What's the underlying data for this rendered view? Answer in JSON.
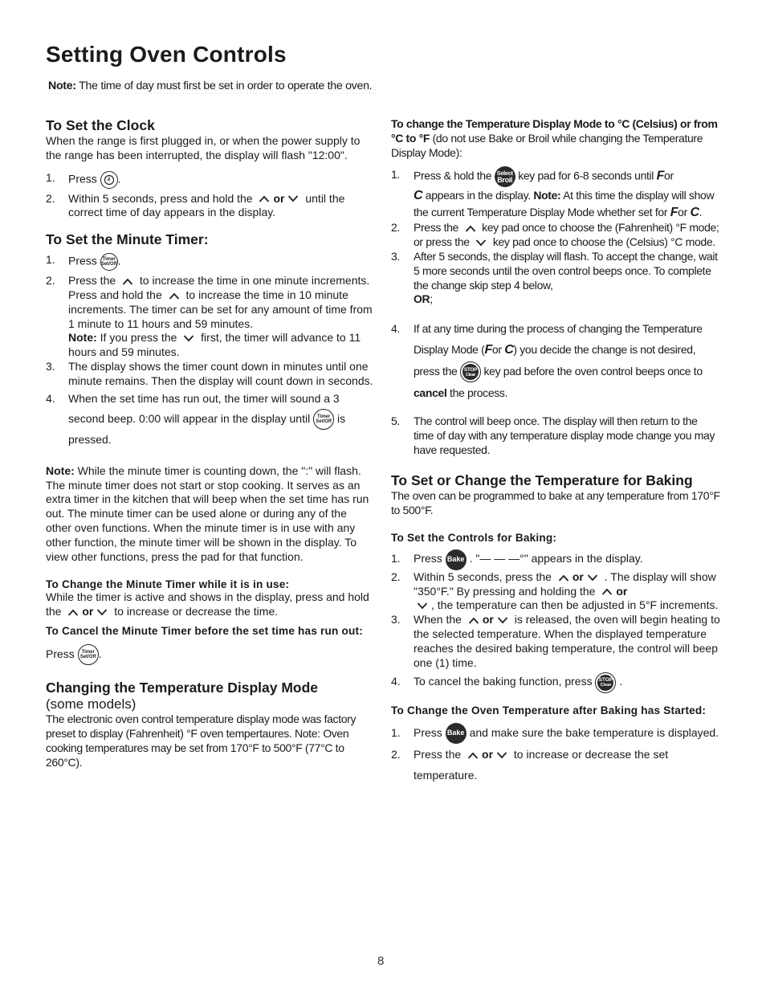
{
  "page": {
    "title": "Setting Oven Controls",
    "page_number": "8"
  },
  "note_top": {
    "label": "Note:",
    "text": " The time of day must first be set in order to operate the oven."
  },
  "icons": {
    "clock": "clock-key",
    "timer": {
      "line1": "Timer",
      "line2": "Set/Off"
    },
    "select_broil": {
      "line1": "Select",
      "line2": "Broil"
    },
    "stop_clear": {
      "line1": "STOP",
      "line2": "Clear"
    },
    "bake": {
      "line1": "Bake"
    },
    "up_arrow": "∧",
    "down_arrow": "∨",
    "seg_f": "F",
    "seg_c": "C"
  },
  "set_clock": {
    "heading": "To Set the Clock",
    "intro": "When the range is first plugged in, or when the power supply to the range has been interrupted, the display will flash \"12:00\".",
    "steps": [
      {
        "num": "1.",
        "a": "Press",
        "b": "."
      },
      {
        "num": "2.",
        "a": "Within 5 seconds, press and hold the",
        "or": "or",
        "b": "until the correct time of day appears in the display."
      }
    ]
  },
  "minute_timer": {
    "heading": "To Set the Minute Timer:",
    "steps": [
      {
        "num": "1.",
        "a": "Press",
        "b": "."
      },
      {
        "num": "2.",
        "a": "Press the",
        "b": "to increase the time in one minute increments. Press and hold the",
        "c": "to increase the time in 10 minute increments. The timer can be set for any amount of time from 1 minute to 11 hours and 59 minutes.",
        "note_label": "Note:",
        "note_a": "If you press the",
        "note_b": "first, the timer will advance to 11 hours and 59 minutes."
      },
      {
        "num": "3.",
        "a": "The display shows the timer count down in minutes until one minute remains. Then the display will count down in seconds."
      },
      {
        "num": "4.",
        "a": "When the set time has run out, the timer will sound a 3 second beep. 0:00 will appear in the display until",
        "b": "is pressed."
      }
    ],
    "note_label": "Note:",
    "note_text": " While the minute timer is counting down, the \":\" will flash. The minute timer does not start or stop cooking. It serves as an extra timer in the kitchen that will beep when the set time has run out. The minute timer can be used alone or during any of the other oven functions. When the minute timer is in use with any other function, the minute timer will be shown in the display. To view other functions, press the pad for that function.",
    "change_heading": "To Change the Minute Timer while it is in use:",
    "change_a": "While the timer is active and shows in the display, press and hold the",
    "change_or": "or",
    "change_b": "to increase or decrease the time.",
    "cancel_heading": "To Cancel the Minute Timer before the set time has run out:",
    "cancel_a": " Press",
    "cancel_b": "."
  },
  "temp_display": {
    "heading": "Changing the Temperature Display Mode",
    "subheading": "(some models)",
    "intro": "The electronic oven control temperature display mode was factory preset to display (Fahrenheit) °F oven tempertaures. Note: Oven cooking temperatures may be set from 170°F to 500°F (77°C to 260°C).",
    "change_heading_bold": "To change the Temperature Display Mode to °C (Celsius) or from °C to °F",
    "change_heading_rest": " (do not use Bake or Broil while changing the Temperature Display Mode):",
    "steps": [
      {
        "num": "1.",
        "a": "Press & hold the",
        "b": "key pad for 6-8 seconds until",
        "or": "or",
        "c": "appears in the display.",
        "note_label": "Note:",
        "d": "At this time the display will show the current Temperature Display Mode whether set for",
        "e": "."
      },
      {
        "num": "2.",
        "a": "Press the",
        "b": "key pad once to choose the (Fahrenheit) °F mode; or press  the",
        "c": "key pad once to choose the (Celsius) °C mode."
      },
      {
        "num": "3.",
        "a": "After 5 seconds, the display will flash. To accept the change, wait 5 more seconds until the oven control beeps once. To complete the change skip step 4 below,",
        "b": "OR",
        "c": ";"
      },
      {
        "num": "4.",
        "a": "If at any time during the process of changing the Temperature Display Mode (",
        "or": "or",
        "b": ") you decide the change is not desired, press the",
        "c": "key pad before the oven control beeps once to",
        "d": "cancel",
        "e": "the process."
      },
      {
        "num": "5.",
        "a": "The control will beep once. The display will then return to the time of day with any temperature display mode change you may have requested."
      }
    ]
  },
  "baking": {
    "heading": "To Set or Change the Temperature for Baking",
    "intro": "The oven can be programmed to bake at any temperature from 170°F to 500°F.",
    "controls_heading": "To Set the Controls for Baking:",
    "steps": [
      {
        "num": "1.",
        "a": "Press",
        "b": ". \"— — —°\" appears in the display."
      },
      {
        "num": "2.",
        "a": "Within 5 seconds, press the",
        "or": "or",
        "b": ". The display will show \"350°F.\" By pressing and holding the",
        "c": ", the temperature can then be adjusted in 5°F increments."
      },
      {
        "num": "3.",
        "a": "When the",
        "or": "or",
        "b": "is released, the oven will begin heating to the selected temperature. When the displayed temperature reaches the desired baking temperature, the control will beep one (1) time."
      },
      {
        "num": "4.",
        "a": "To cancel the baking function, press",
        "b": "."
      }
    ],
    "after_heading": "To Change the Oven Temperature after Baking has Started:",
    "after_steps": [
      {
        "num": "1.",
        "a": "Press",
        "b": "and make sure the bake temperature is displayed."
      },
      {
        "num": "2.",
        "a": "Press the",
        "or": "or",
        "b": "to increase or decrease the set temperature."
      }
    ]
  }
}
